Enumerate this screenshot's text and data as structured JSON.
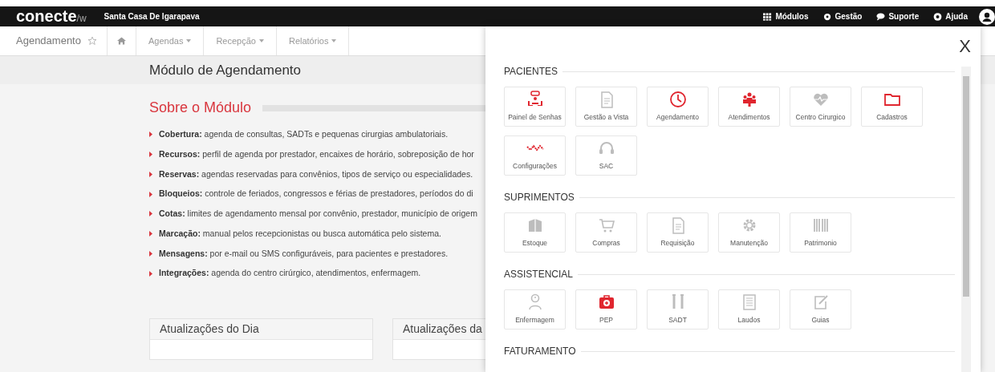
{
  "topbar": {
    "logo": "conecte",
    "logo_suffix": "/w",
    "organization": "Santa Casa De Igarapava",
    "menu": [
      {
        "label": "Módulos",
        "kind": "grid"
      },
      {
        "label": "Gestão",
        "kind": "gear"
      },
      {
        "label": "Suporte",
        "kind": "chat"
      },
      {
        "label": "Ajuda",
        "kind": "lifebuoy"
      }
    ]
  },
  "navbar": {
    "module": "Agendamento",
    "menus": [
      "Agendas",
      "Recepção",
      "Relatórios"
    ]
  },
  "page_title": "Módulo de Agendamento",
  "about": {
    "title": "Sobre o Módulo",
    "items": [
      "**Cobertura:** agenda de consultas, SADTs e pequenas cirurgias ambulatoriais.",
      "**Recursos:** perfil de agenda por prestador, encaixes de horário, sobreposição de hor",
      "**Reservas:** agendas reservadas para convênios, tipos de serviço ou especialidades.",
      "**Bloqueios:** controle de feriados, congressos e férias de prestadores, períodos do di",
      "**Cotas:** limites de agendamento mensal por convênio, prestador, município de origem",
      "**Marcação:** manual pelos recepcionistas ou busca automática pelo sistema.",
      "**Mensagens:** por e-mail ou SMS configuráveis, para pacientes e prestadores.",
      "**Integrações:** agenda do centro cirúrgico, atendimentos, enfermagem."
    ]
  },
  "updates": [
    "Atualizações do Dia",
    "Atualizações da"
  ],
  "modules_panel": {
    "close": "X",
    "sections": [
      {
        "title": "PACIENTES",
        "modules": [
          {
            "label": "Painel de Senhas",
            "kind": "queue",
            "available": true
          },
          {
            "label": "Gestão a Vista",
            "kind": "document",
            "available": false
          },
          {
            "label": "Agendamento",
            "kind": "clock",
            "available": true
          },
          {
            "label": "Atendimentos",
            "kind": "people",
            "available": true
          },
          {
            "label": "Centro Cirurgico",
            "kind": "heart",
            "available": false
          },
          {
            "label": "Cadastros",
            "kind": "folder",
            "available": true
          },
          {
            "label": "Configurações",
            "kind": "wave",
            "available": true
          },
          {
            "label": "SAC",
            "kind": "headset",
            "available": false
          }
        ]
      },
      {
        "title": "SUPRIMENTOS",
        "modules": [
          {
            "label": "Estoque",
            "kind": "box",
            "available": false
          },
          {
            "label": "Compras",
            "kind": "cart",
            "available": false
          },
          {
            "label": "Requisição",
            "kind": "document",
            "available": false
          },
          {
            "label": "Manutenção",
            "kind": "gear",
            "available": false
          },
          {
            "label": "Patrimonio",
            "kind": "barcode",
            "available": false
          }
        ]
      },
      {
        "title": "ASSISTENCIAL",
        "modules": [
          {
            "label": "Enfermagem",
            "kind": "nurse",
            "available": false
          },
          {
            "label": "PEP",
            "kind": "medkit",
            "available": true
          },
          {
            "label": "SADT",
            "kind": "tools",
            "available": false
          },
          {
            "label": "Laudos",
            "kind": "list",
            "available": false
          },
          {
            "label": "Guias",
            "kind": "edit",
            "available": false
          }
        ]
      },
      {
        "title": "FATURAMENTO"
      }
    ]
  }
}
